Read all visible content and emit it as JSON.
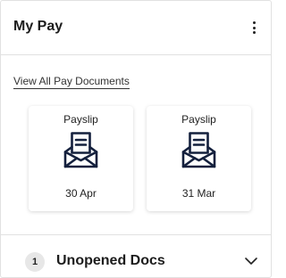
{
  "card": {
    "title": "My Pay",
    "menu_icon": "more-vertical-icon"
  },
  "links": {
    "view_all": "View All Pay Documents"
  },
  "documents": [
    {
      "label": "Payslip",
      "date": "30 Apr",
      "icon": "envelope-document-icon"
    },
    {
      "label": "Payslip",
      "date": "31 Mar",
      "icon": "envelope-document-icon"
    }
  ],
  "footer": {
    "count": "1",
    "label": "Unopened Docs",
    "expand_icon": "chevron-down-icon"
  },
  "colors": {
    "icon_navy": "#14203d",
    "border": "#e1e1e1",
    "badge_bg": "#e7e7e7"
  }
}
